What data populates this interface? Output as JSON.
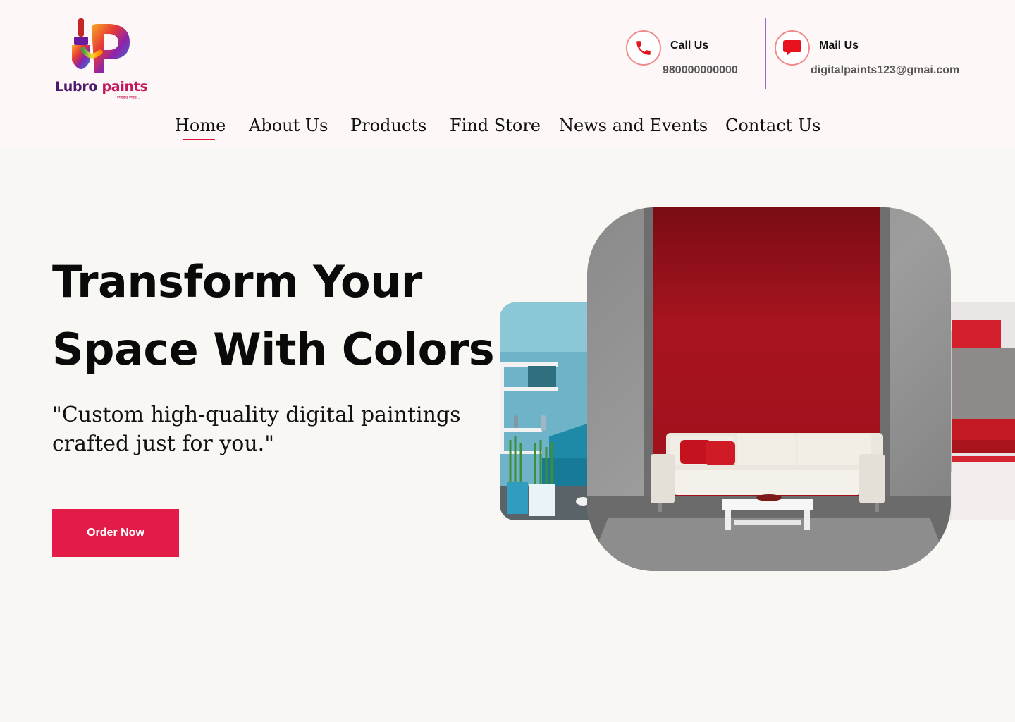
{
  "brand": {
    "name_part1": "Lubro",
    "name_part2": "paints",
    "tagline": "रंगसाथ रंगाउ..."
  },
  "contacts": {
    "call": {
      "title": "Call Us",
      "value": "980000000000",
      "icon": "phone-icon"
    },
    "mail": {
      "title": "Mail Us",
      "value": "digitalpaints123@gmai.com",
      "icon": "chat-bubble-icon"
    }
  },
  "nav": {
    "active": "Home",
    "items": [
      "Home",
      "About Us",
      "Products",
      "Find Store",
      "News and Events",
      "Contact Us"
    ]
  },
  "hero": {
    "title_line1": "Transform Your",
    "title_line2": "Space With Colors",
    "subtitle": " \"Custom high-quality digital paintings crafted just for you.\"",
    "cta": "Order Now"
  },
  "colors": {
    "accent": "#e31b48",
    "header_bg": "#fdf7f7",
    "page_bg": "#f9f7f4",
    "icon_ring": "#f08a8a",
    "divider": "#9a6bd0"
  }
}
